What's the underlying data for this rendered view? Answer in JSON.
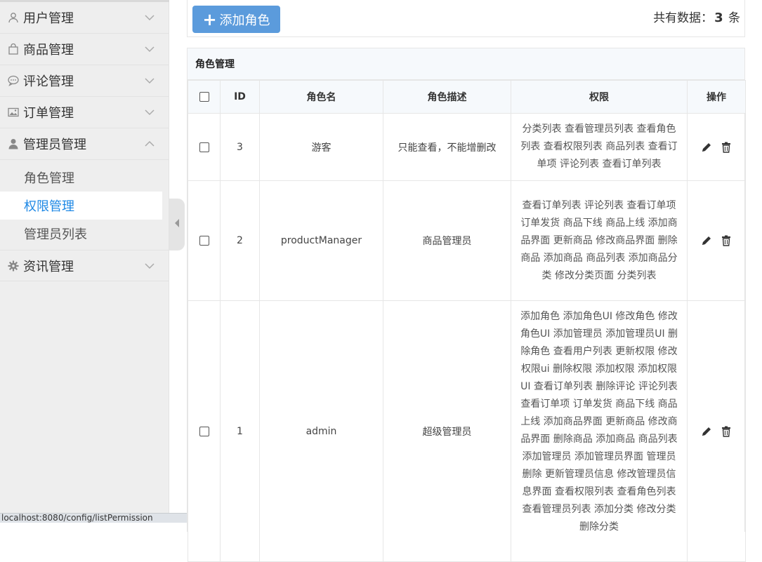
{
  "sidebar": {
    "menus": [
      {
        "label": "用户管理",
        "icon": "user-icon",
        "expanded": false
      },
      {
        "label": "商品管理",
        "icon": "shopping-bag-icon",
        "expanded": false
      },
      {
        "label": "评论管理",
        "icon": "comment-icon",
        "expanded": false
      },
      {
        "label": "订单管理",
        "icon": "image-icon",
        "expanded": false
      },
      {
        "label": "管理员管理",
        "icon": "person-icon",
        "expanded": true
      },
      {
        "label": "资讯管理",
        "icon": "gear-icon",
        "expanded": false
      }
    ],
    "submenu": [
      {
        "label": "角色管理",
        "active": false
      },
      {
        "label": "权限管理",
        "active": true
      },
      {
        "label": "管理员列表",
        "active": false
      }
    ]
  },
  "status_bar": {
    "url": "localhost:8080/config/listPermission"
  },
  "toolbar": {
    "add_button_label": "添加角色",
    "total_prefix": "共有数据：",
    "total_count": "3",
    "total_suffix": "条"
  },
  "panel": {
    "title": "角色管理",
    "columns": [
      "ID",
      "角色名",
      "角色描述",
      "权限",
      "操作"
    ],
    "rows": [
      {
        "id": "3",
        "name": "游客",
        "desc": "只能查看，不能增删改",
        "perms": "分类列表 查看管理员列表 查看角色列表 查看权限列表 商品列表 查看订单项 评论列表 查看订单列表"
      },
      {
        "id": "2",
        "name": "productManager",
        "desc": "商品管理员",
        "perms": "查看订单列表 评论列表 查看订单项 订单发货 商品下线 商品上线 添加商品界面 更新商品 修改商品界面 删除商品 添加商品 商品列表 添加商品分类 修改分类页面 分类列表"
      },
      {
        "id": "1",
        "name": "admin",
        "desc": "超级管理员",
        "perms": "添加角色 添加角色UI 修改角色 修改角色UI 添加管理员 添加管理员UI 删除角色 查看用户列表 更新权限 修改权限ui 删除权限 添加权限 添加权限UI 查看订单列表 删除评论 评论列表 查看订单项 订单发货 商品下线 商品上线 添加商品界面 更新商品 修改商品界面 删除商品 添加商品 商品列表 添加管理员 添加管理员界面 管理员删除 更新管理员信息 修改管理员信息界面 查看权限列表 查看角色列表 查看管理员列表 添加分类 修改分类 删除分类"
      }
    ]
  },
  "colors": {
    "accent": "#1e88e5",
    "button": "#5b9bdc"
  }
}
